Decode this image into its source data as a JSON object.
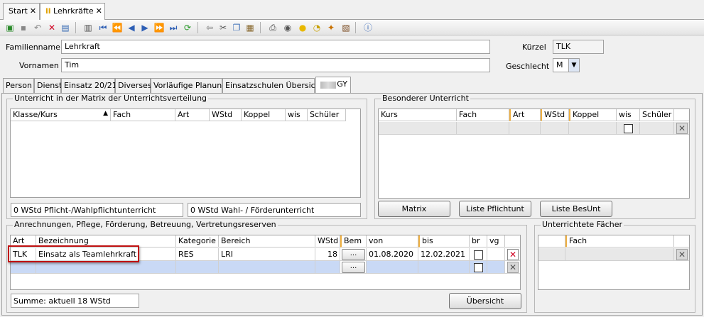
{
  "tabs": {
    "start": "Start",
    "lehrkraefte": "Lehrkräfte",
    "close": "✕"
  },
  "toolbar": {
    "icons": [
      "new-icon",
      "save-icon",
      "undo-icon",
      "delete-icon",
      "filter-icon",
      "copy-form-icon",
      "first-icon",
      "prev-page-icon",
      "prev-icon",
      "next-icon",
      "next-page-icon",
      "last-icon",
      "refresh-icon",
      "back-arrow-icon",
      "cut-icon",
      "copy-icon",
      "paste-icon",
      "print-icon",
      "preview-icon",
      "idea-icon",
      "clock-icon",
      "settings-icon",
      "report-icon",
      "help-icon"
    ]
  },
  "form": {
    "familienname_label": "Familienname",
    "familienname_value": "Lehrkraft",
    "vorname_label": "Vornamen",
    "vorname_value": "Tim",
    "kuerzel_label": "Kürzel",
    "kuerzel_value": "TLK",
    "geschlecht_label": "Geschlecht",
    "geschlecht_value": "M"
  },
  "subtabs": [
    "Person",
    "Dienst",
    "Einsatz 20/21",
    "Diverses",
    "Vorläufige Planung",
    "Einsatzschulen Übersicht",
    "GY"
  ],
  "unterricht": {
    "title": "Unterricht in der Matrix der Unterrichtsverteilung",
    "columns": [
      "Klasse/Kurs",
      "Fach",
      "Art",
      "WStd",
      "Koppel",
      "wis",
      "Schüler"
    ],
    "status1": "0 WStd Pflicht-/Wahlpflichtunterricht",
    "status2": "0 WStd Wahl- / Förderunterricht"
  },
  "besonderer": {
    "title": "Besonderer Unterricht",
    "columns": [
      "Kurs",
      "Fach",
      "Art",
      "WStd",
      "Koppel",
      "wis",
      "Schüler"
    ],
    "buttons": [
      "Matrix",
      "Liste Pflichtunt",
      "Liste BesUnt"
    ]
  },
  "anrechnungen": {
    "title": "Anrechnungen, Pflege, Förderung, Betreuung, Vertretungsreserven",
    "columns": [
      "Art",
      "Bezeichnung",
      "Kategorie",
      "Bereich",
      "WStd",
      "Bem",
      "von",
      "bis",
      "br",
      "vg"
    ],
    "row": {
      "art": "TLK",
      "bezeichnung": "Einsatz als Teamlehrkraft",
      "kategorie": "RES",
      "bereich": "LRI",
      "wstd": "18",
      "bem": "...",
      "von": "01.08.2020",
      "bis": "12.02.2021"
    },
    "new_bem": "...",
    "summe": "Summe: aktuell 18 WStd",
    "uebersicht": "Übersicht"
  },
  "faecher": {
    "title": "Unterrichtete Fächer",
    "columns": [
      "Fach"
    ]
  }
}
